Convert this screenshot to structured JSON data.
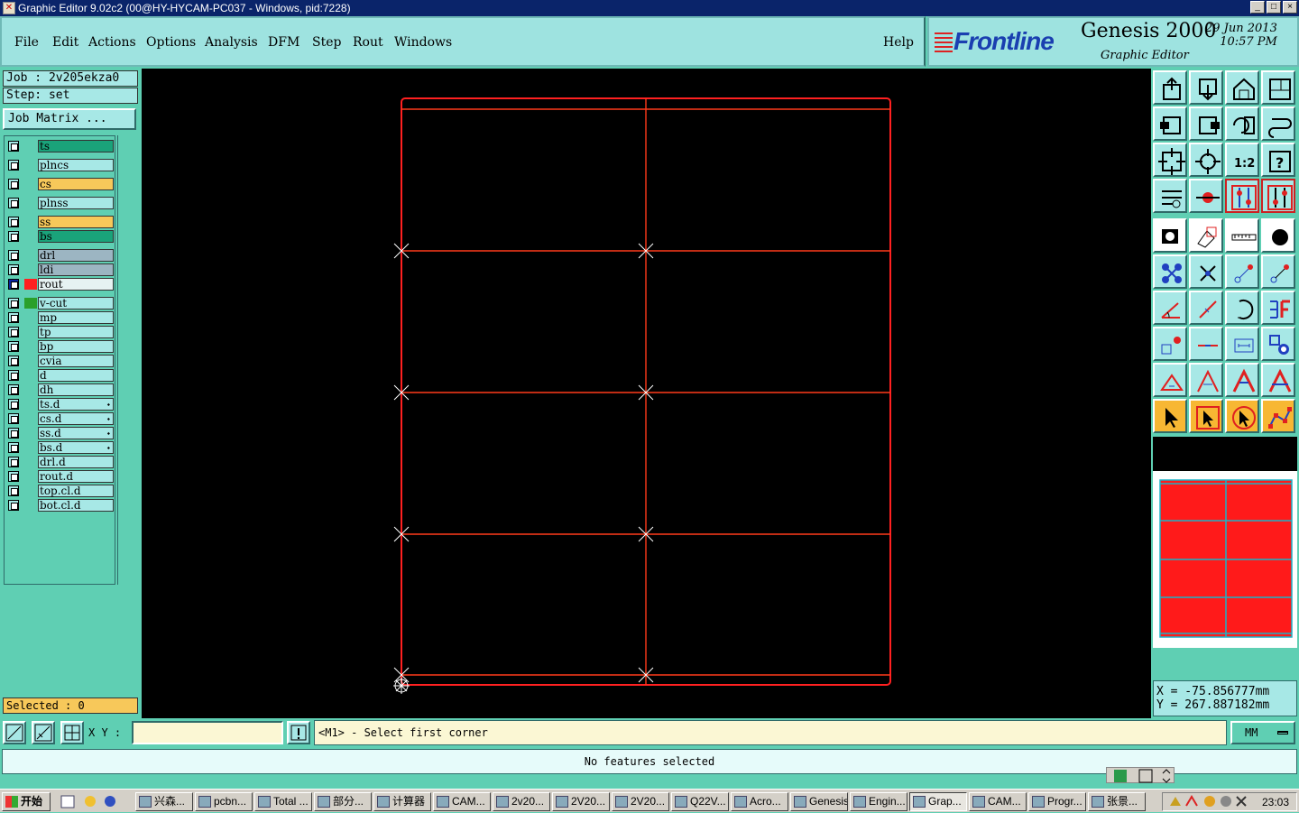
{
  "window": {
    "title": "Graphic Editor 9.02c2 (00@HY-HYCAM-PC037 - Windows, pid:7228)",
    "buttons": [
      "_",
      "□",
      "×"
    ]
  },
  "menu": {
    "items": [
      "File",
      "Edit",
      "Actions",
      "Options",
      "Analysis",
      "DFM",
      "Step",
      "Rout",
      "Windows"
    ],
    "help": "Help"
  },
  "brand": {
    "logo": "Frontline",
    "product": "Genesis 2000",
    "subtitle": "Graphic Editor",
    "date": "29 Jun 2013",
    "time": "10:57 PM"
  },
  "job": {
    "job_label": "Job : 2v205ekza0",
    "step_label": "Step: set",
    "job_matrix": "Job Matrix ..."
  },
  "layers": [
    {
      "name": "ts",
      "color": "#1aa37a",
      "swatch": ""
    },
    {
      "name": "plncs",
      "color": "#a7e8e6",
      "swatch": ""
    },
    {
      "name": "cs",
      "color": "#f7c85a",
      "swatch": ""
    },
    {
      "name": "plnss",
      "color": "#a7e8e6",
      "swatch": ""
    },
    {
      "name": "ss",
      "color": "#f7c85a",
      "swatch": ""
    },
    {
      "name": "bs",
      "color": "#1aa37a",
      "swatch": ""
    },
    {
      "name": "drl",
      "color": "#9cb5c2",
      "swatch": ""
    },
    {
      "name": "ldi",
      "color": "#9cb5c2",
      "swatch": ""
    },
    {
      "name": "rout",
      "color": "#e6f2f2",
      "swatch": "#ff2020"
    },
    {
      "name": "v-cut",
      "color": "#a7e8e6",
      "swatch": "#2aa02a"
    },
    {
      "name": "mp",
      "color": "#a7e8e6",
      "swatch": ""
    },
    {
      "name": "tp",
      "color": "#a7e8e6",
      "swatch": ""
    },
    {
      "name": "bp",
      "color": "#a7e8e6",
      "swatch": ""
    },
    {
      "name": "cvia",
      "color": "#a7e8e6",
      "swatch": ""
    },
    {
      "name": "d",
      "color": "#a7e8e6",
      "swatch": ""
    },
    {
      "name": "dh",
      "color": "#a7e8e6",
      "swatch": ""
    },
    {
      "name": "ts.d",
      "color": "#a7e8e6",
      "swatch": ""
    },
    {
      "name": "cs.d",
      "color": "#a7e8e6",
      "swatch": ""
    },
    {
      "name": "ss.d",
      "color": "#a7e8e6",
      "swatch": ""
    },
    {
      "name": "bs.d",
      "color": "#a7e8e6",
      "swatch": ""
    },
    {
      "name": "drl.d",
      "color": "#a7e8e6",
      "swatch": ""
    },
    {
      "name": "rout.d",
      "color": "#a7e8e6",
      "swatch": ""
    },
    {
      "name": "top.cl.d",
      "color": "#a7e8e6",
      "swatch": ""
    },
    {
      "name": "bot.cl.d",
      "color": "#a7e8e6",
      "swatch": ""
    }
  ],
  "selected": "Selected : 0",
  "coords": {
    "x": "X = -75.856777mm",
    "y": "Y = 267.887182mm"
  },
  "command": {
    "xy_label": "X Y :",
    "xy_value": "",
    "prompt": "<M1> - Select first corner",
    "units": "MM",
    "status": "No features selected"
  },
  "tool_icons": [
    "open-job-icon",
    "save-icon",
    "home-icon",
    "window-icon",
    "snap-left-icon",
    "snap-right-icon",
    "undo-view-icon",
    "redo-view-icon",
    "zoom-fit-icon",
    "zoom-home-icon",
    "scale-1-2-icon",
    "help-icon",
    "settings-icon",
    "measure-icon",
    "layers-icon",
    "layers-alt-icon",
    "pad-icon",
    "edit-shape-icon",
    "ruler-icon",
    "circle-icon",
    "nodes-icon",
    "cross-icon",
    "connect-icon",
    "move-point-icon",
    "angle-icon",
    "line-icon",
    "arc-icon",
    "text-f-icon",
    "copy-icon",
    "split-icon",
    "dimension-icon",
    "group-icon",
    "triangle-icon",
    "peak-icon",
    "arch-icon",
    "arch-alt-icon",
    "pointer-icon",
    "select-icon",
    "select-alt-icon",
    "route-icon"
  ],
  "taskbar": {
    "start": "开始",
    "tasks": [
      "兴森...",
      "pcbn...",
      "Total ...",
      "部分...",
      "计算器",
      "CAM...",
      "2v20...",
      "2V20...",
      "2V20...",
      "Q22V...",
      "Acro...",
      "Genesis",
      "Engin...",
      "Grap...",
      "CAM...",
      "Progr...",
      "张景..."
    ],
    "active_task": "Grap...",
    "clock": "23:03"
  },
  "colors": {
    "panel": "#5fcfb3",
    "light_panel": "#a7e8e6",
    "canvas": "#000000",
    "rout_line": "#ff2020",
    "cross_marker": "#ffffff"
  }
}
